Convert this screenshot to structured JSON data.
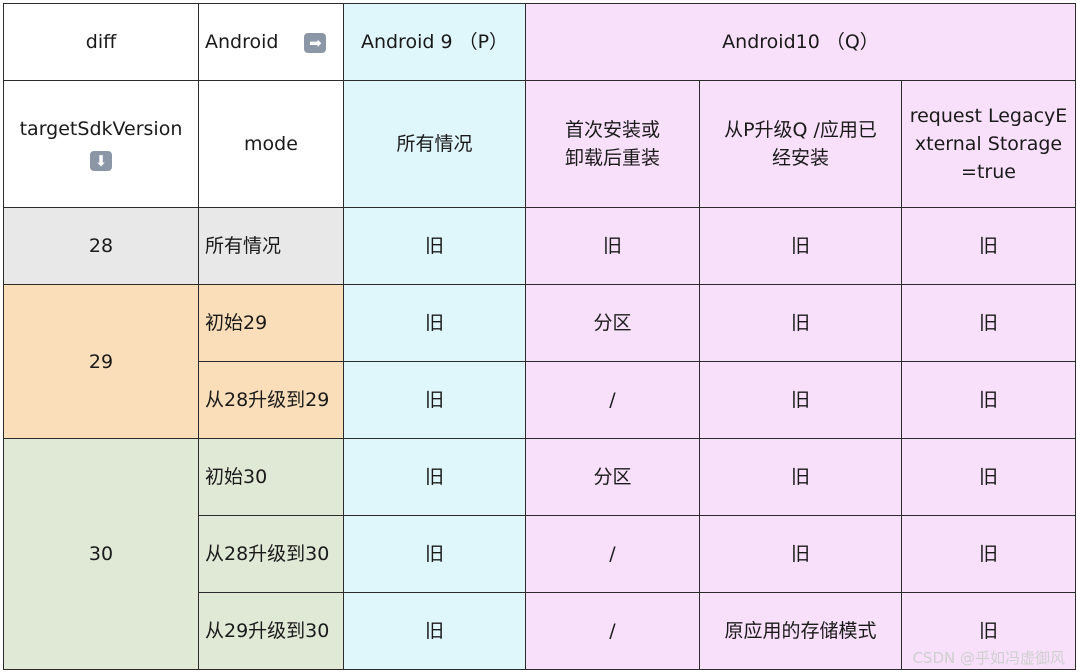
{
  "chart_data": {
    "type": "table",
    "header": {
      "diff": "diff",
      "android": "Android",
      "android9": "Android 9 （P）",
      "android10": "Android10 （Q）",
      "target_sdk": "targetSdkVersion",
      "mode": "mode",
      "p_all": "所有情况",
      "q_fresh": "首次安装或卸载后重装",
      "q_upgrade": "从P升级Q /应用已经安装",
      "q_legacy": "request LegacyExternal Storage=true"
    },
    "rows": [
      {
        "sdk": "28",
        "mode": "所有情况",
        "p": "旧",
        "q_fresh": "旧",
        "q_upgrade": "旧",
        "q_legacy": "旧"
      },
      {
        "sdk": "29",
        "mode": "初始29",
        "p": "旧",
        "q_fresh": "分区",
        "q_upgrade": "旧",
        "q_legacy": "旧"
      },
      {
        "sdk": "29",
        "mode": "从28升级到29",
        "p": "旧",
        "q_fresh": "/",
        "q_upgrade": "旧",
        "q_legacy": "旧"
      },
      {
        "sdk": "30",
        "mode": "初始30",
        "p": "旧",
        "q_fresh": "分区",
        "q_upgrade": "旧",
        "q_legacy": "旧"
      },
      {
        "sdk": "30",
        "mode": "从28升级到30",
        "p": "旧",
        "q_fresh": "/",
        "q_upgrade": "旧",
        "q_legacy": "旧"
      },
      {
        "sdk": "30",
        "mode": "从29升级到30",
        "p": "旧",
        "q_fresh": "/",
        "q_upgrade": "原应用的存储模式",
        "q_legacy": "旧"
      }
    ],
    "colors": {
      "android9_column": "#dff6fb",
      "android10_columns": "#f8e0fb",
      "sdk28_row": "#e8e8e8",
      "sdk29_rows": "#f9deb9",
      "sdk30_rows": "#dfe9d6"
    }
  },
  "icons": {
    "right_arrow": "➡",
    "down_arrow": "⬇"
  },
  "watermark": "CSDN @乎如冯虚御风"
}
